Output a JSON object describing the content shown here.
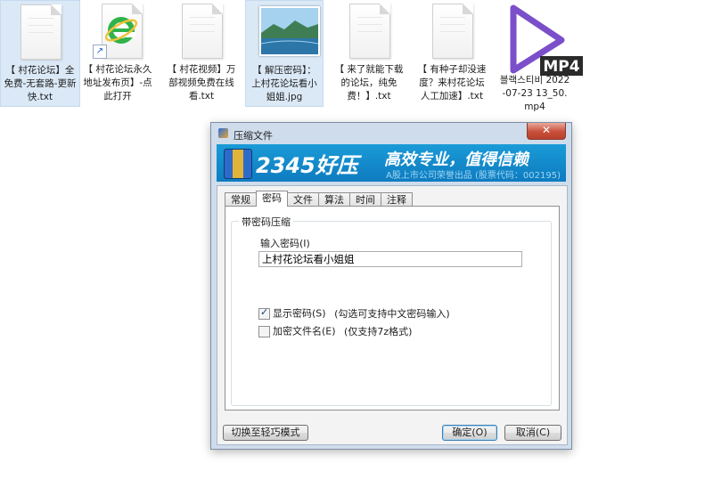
{
  "desktop": {
    "files": [
      {
        "label": "【 村花论坛】全免费-无套路-更新快.txt",
        "icon": "text-file-icon"
      },
      {
        "label": "【 村花论坛永久地址发布页】-点此打开",
        "icon": "ie-shortcut-icon"
      },
      {
        "label": "【 村花视频】万部视频免费在线看.txt",
        "icon": "text-file-icon"
      },
      {
        "label": "【 解压密码】：上村花论坛看小姐姐.jpg",
        "icon": "image-file-icon"
      },
      {
        "label": "【 来了就能下载的论坛，纯免费！】.txt",
        "icon": "text-file-icon"
      },
      {
        "label": "【 有种子却没速度？来村花论坛人工加速】.txt",
        "icon": "text-file-icon"
      },
      {
        "label": "블랙스티비 2022-07-23 13_50.mp4",
        "icon": "mp4-file-icon",
        "badge": "MP4"
      }
    ]
  },
  "dialog": {
    "title": "压缩文件",
    "close_glyph": "✕",
    "banner": {
      "brand": "2345好压",
      "slogan": "高效专业，值得信赖",
      "subtitle": "A股上市公司荣誉出品 (股票代码：002195)"
    },
    "tabs": [
      "常规",
      "密码",
      "文件",
      "算法",
      "时间",
      "注释"
    ],
    "active_tab": "密码",
    "group_title": "带密码压缩",
    "password_label": "输入密码(I)",
    "password_value": "上村花论坛看小姐姐",
    "show_password": {
      "label": "显示密码(S)",
      "hint": "(勾选可支持中文密码输入)",
      "checked": true
    },
    "encrypt_names": {
      "label": "加密文件名(E)",
      "hint": "(仅支持7z格式)",
      "checked": false
    },
    "buttons": {
      "simple_mode": "切换至轻巧模式",
      "ok": "确定(O)",
      "cancel": "取消(C)"
    }
  }
}
